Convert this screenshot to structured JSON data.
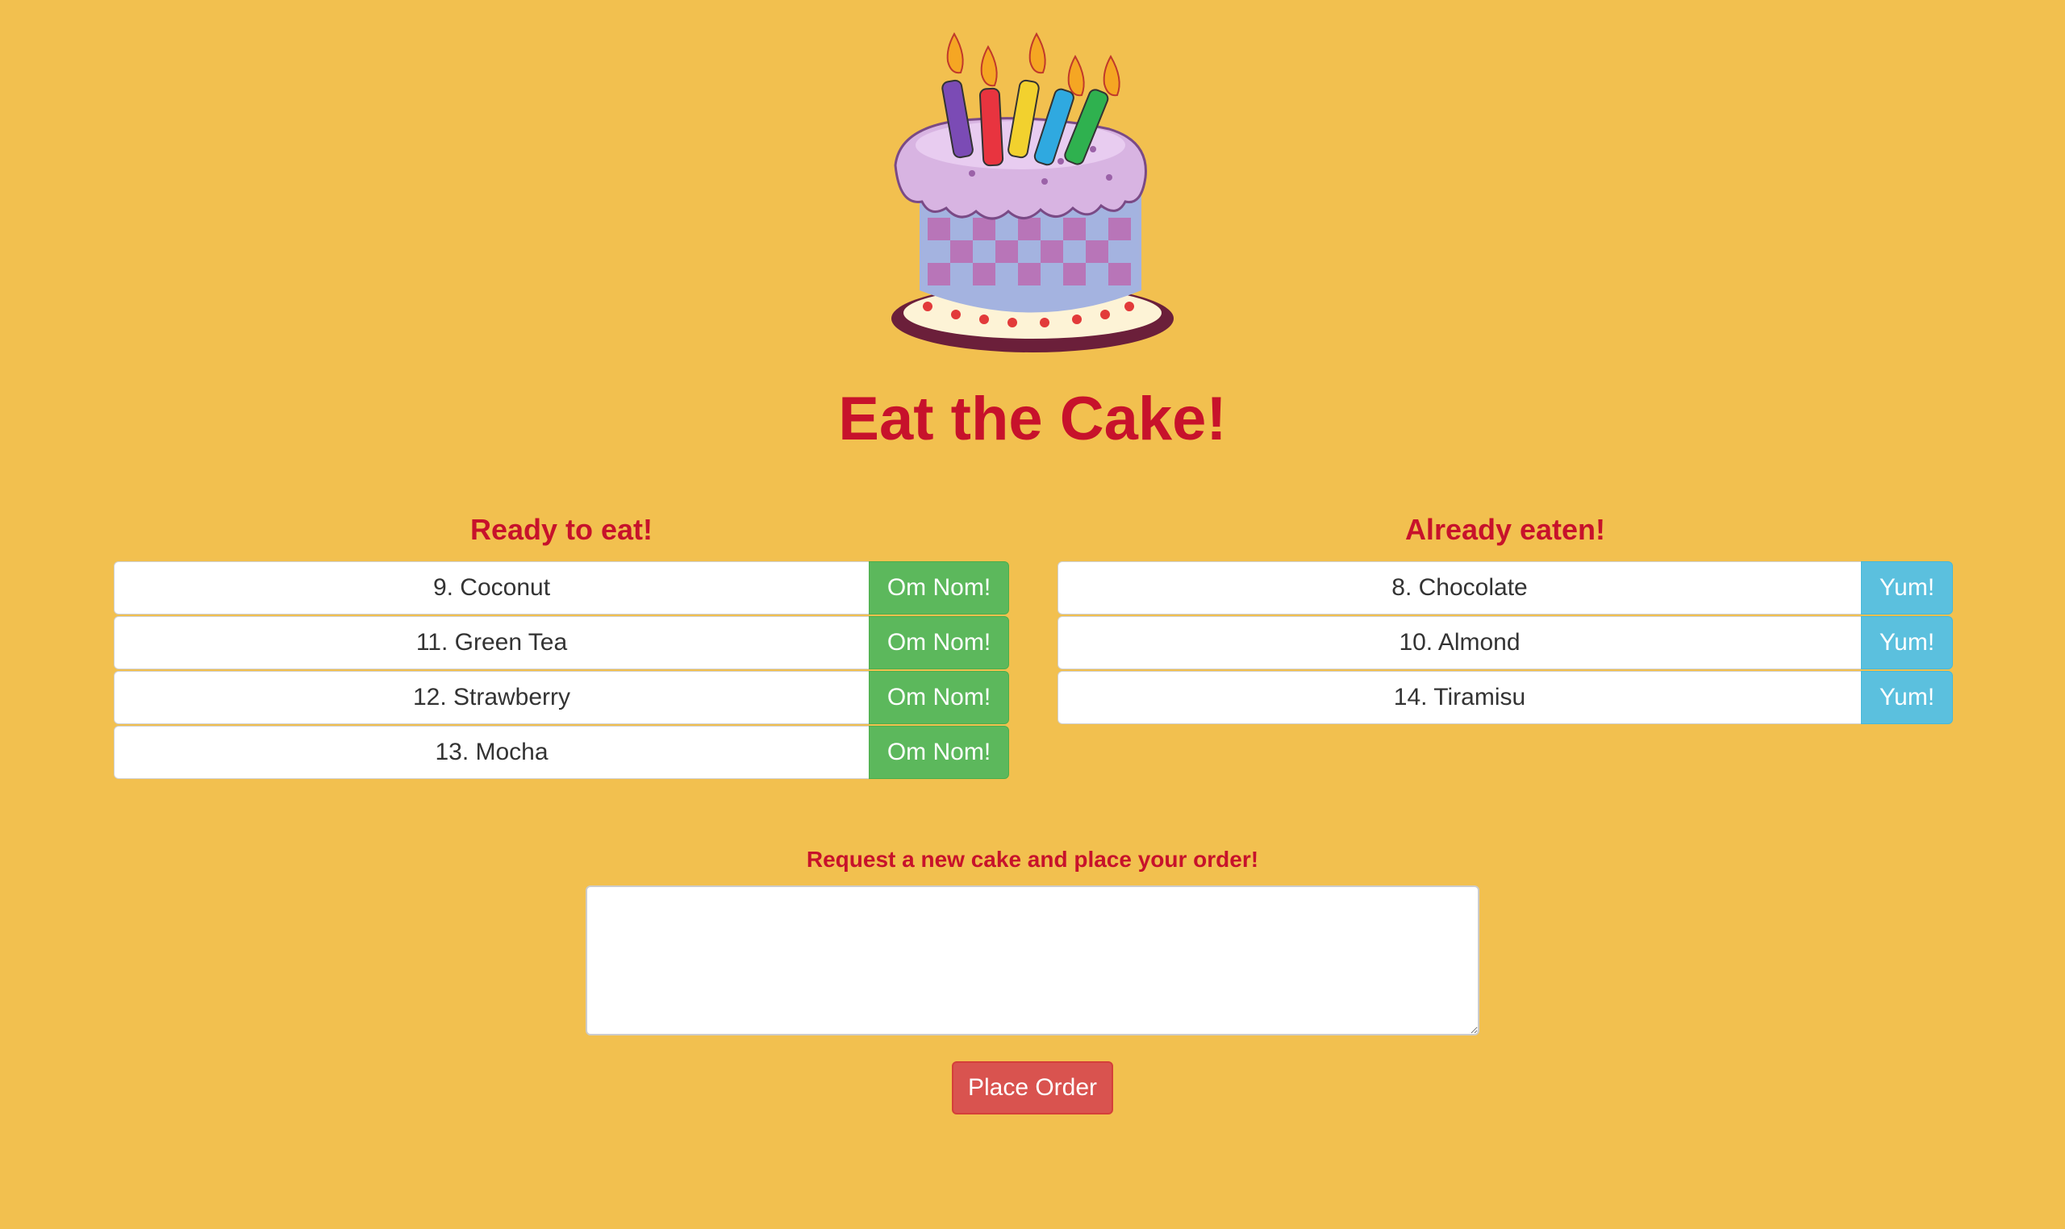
{
  "page": {
    "title": "Eat the Cake!"
  },
  "ready": {
    "heading": "Ready to eat!",
    "button_label": "Om Nom!",
    "items": [
      {
        "label": "9. Coconut"
      },
      {
        "label": "11. Green Tea"
      },
      {
        "label": "12. Strawberry"
      },
      {
        "label": "13. Mocha"
      }
    ]
  },
  "eaten": {
    "heading": "Already eaten!",
    "button_label": "Yum!",
    "items": [
      {
        "label": "8. Chocolate"
      },
      {
        "label": "10. Almond"
      },
      {
        "label": "14. Tiramisu"
      }
    ]
  },
  "order": {
    "label": "Request a new cake and place your order!",
    "input_value": "",
    "button_label": "Place Order"
  },
  "colors": {
    "background": "#f2c04f",
    "accent_red": "#c7122b",
    "eat_button": "#5cb85c",
    "yum_button": "#5bc0de",
    "order_button": "#d9534f"
  }
}
